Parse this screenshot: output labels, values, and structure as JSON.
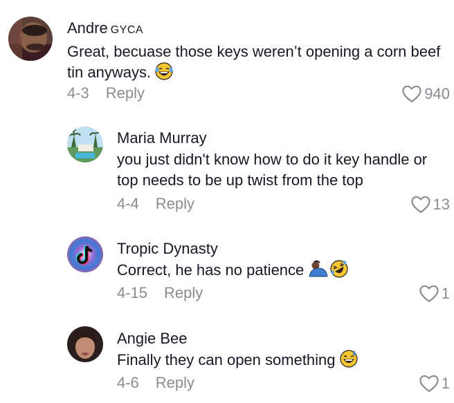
{
  "comments": [
    {
      "username": "Andre",
      "badge": "GYCA",
      "text": "Great, becuase those keys weren’t opening a corn beef tin anyways.",
      "emoji": "laughing-tears",
      "date": "4-3",
      "reply_label": "Reply",
      "likes": "940"
    },
    {
      "username": "Maria Murray",
      "text": "you just didn't know how to do it key handle or top needs to be up twist from the top",
      "date": "4-4",
      "reply_label": "Reply",
      "likes": "13"
    },
    {
      "username": "Tropic Dynasty",
      "text": "Correct, he has no patience",
      "emoji": "person-bowing, rolling-laughing",
      "date": "4-15",
      "reply_label": "Reply",
      "likes": "1"
    },
    {
      "username": "Angie Bee",
      "text": "Finally they can open something",
      "emoji": "sweat-smile",
      "date": "4-6",
      "reply_label": "Reply",
      "likes": "1"
    }
  ]
}
